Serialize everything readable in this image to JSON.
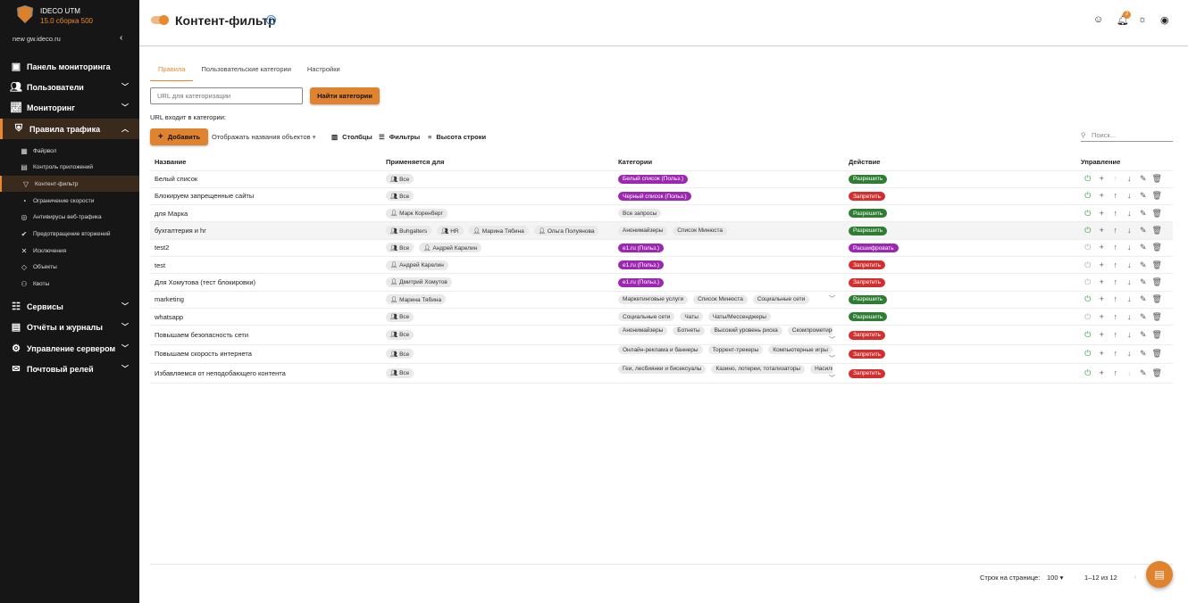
{
  "sidebar": {
    "product": "IDECO UTM",
    "version": "15.0 сборка 500",
    "host": "new gw.ideco.ru",
    "items": [
      {
        "label": "Панель мониторинга",
        "icon": "monitor-icon"
      },
      {
        "label": "Пользователи",
        "icon": "users-icon"
      },
      {
        "label": "Мониторинг",
        "icon": "chart-icon"
      },
      {
        "label": "Правила трафика",
        "icon": "shield-icon"
      },
      {
        "label": "Сервисы",
        "icon": "sliders-icon"
      },
      {
        "label": "Отчёты и журналы",
        "icon": "report-icon"
      },
      {
        "label": "Управление сервером",
        "icon": "gear-icon"
      },
      {
        "label": "Почтовый релей",
        "icon": "mail-icon"
      }
    ],
    "subitems": [
      {
        "label": "Файрвол"
      },
      {
        "label": "Контроль приложений"
      },
      {
        "label": "Контент-фильтр"
      },
      {
        "label": "Ограничение скорости"
      },
      {
        "label": "Антивирусы веб-трафика"
      },
      {
        "label": "Предотвращение вторжений"
      },
      {
        "label": "Исключения"
      },
      {
        "label": "Объекты"
      },
      {
        "label": "Квоты"
      }
    ]
  },
  "header": {
    "title": "Контент-фильтр",
    "notifications": "2"
  },
  "tabs": [
    "Правила",
    "Пользовательские категории",
    "Настройки"
  ],
  "url_check": {
    "placeholder": "URL для категоризации",
    "button": "Найти категории",
    "result_label": "URL входит в категории:"
  },
  "toolbar": {
    "add": "Добавить",
    "display_names": "Отображать названия объектов",
    "columns": "Столбцы",
    "filters": "Фильтры",
    "row_height": "Высота строки",
    "search_placeholder": "Поиск..."
  },
  "colors": {
    "accent": "#e0832e",
    "allow": "#2e7d32",
    "deny": "#d32f2f",
    "decrypt": "#9c27b0"
  },
  "table": {
    "headers": [
      "Название",
      "Применяется для",
      "Категории",
      "Действие",
      "Управление"
    ],
    "rows": [
      {
        "name": "Белый список",
        "applies": [
          [
            "g",
            "Все"
          ]
        ],
        "cats": [
          [
            "p",
            "Белый список (Польз.)"
          ]
        ],
        "action": "Разрешить",
        "type": "allow",
        "enabled": true
      },
      {
        "name": "Блокируем запрещенные сайты",
        "applies": [
          [
            "g",
            "Все"
          ]
        ],
        "cats": [
          [
            "p",
            "Черный список (Польз.)"
          ]
        ],
        "action": "Запретить",
        "type": "deny",
        "enabled": true
      },
      {
        "name": "для Марка",
        "applies": [
          [
            "u",
            "Марк Коренберг"
          ]
        ],
        "cats": [
          [
            "n",
            "Все запросы"
          ]
        ],
        "action": "Разрешить",
        "type": "allow",
        "enabled": true
      },
      {
        "name": "бухгалтерия и hr",
        "applies": [
          [
            "g",
            "Buhgalters"
          ],
          [
            "g",
            "HR"
          ],
          [
            "u",
            "Марина Тябина"
          ],
          [
            "u",
            "Ольга Полуянова"
          ]
        ],
        "cats": [
          [
            "n",
            "Анонимайзеры"
          ],
          [
            "n",
            "Список Минюста"
          ]
        ],
        "action": "Разрешить",
        "type": "allow",
        "enabled": true
      },
      {
        "name": "test2",
        "applies": [
          [
            "g",
            "Все"
          ],
          [
            "u",
            "Андрей Карелин"
          ]
        ],
        "cats": [
          [
            "p",
            "e1.ru (Польз.)"
          ]
        ],
        "action": "Расшифровать",
        "type": "decrypt",
        "enabled": false
      },
      {
        "name": "test",
        "applies": [
          [
            "u",
            "Андрей Карелин"
          ]
        ],
        "cats": [
          [
            "p",
            "e1.ru (Польз.)"
          ]
        ],
        "action": "Запретить",
        "type": "deny",
        "enabled": false
      },
      {
        "name": "Для Хомутова (тест блокировки)",
        "applies": [
          [
            "u",
            "Дмитрий Хомутов"
          ]
        ],
        "cats": [
          [
            "p",
            "e1.ru (Польз.)"
          ]
        ],
        "action": "Запретить",
        "type": "deny",
        "enabled": false
      },
      {
        "name": "marketing",
        "applies": [
          [
            "u",
            "Марина Тябина"
          ]
        ],
        "cats": [
          [
            "n",
            "Маркетинговые услуги"
          ],
          [
            "n",
            "Список Минюста"
          ],
          [
            "n",
            "Социальные сети"
          ]
        ],
        "more": true,
        "action": "Разрешить",
        "type": "allow",
        "enabled": true
      },
      {
        "name": "whatsapp",
        "applies": [
          [
            "g",
            "Все"
          ]
        ],
        "cats": [
          [
            "n",
            "Социальные сети"
          ],
          [
            "n",
            "Чаты"
          ],
          [
            "n",
            "Чаты/Мессенджеры"
          ]
        ],
        "action": "Разрешить",
        "type": "allow",
        "enabled": false
      },
      {
        "name": "Повышаем безопасность сети",
        "applies": [
          [
            "g",
            "Все"
          ]
        ],
        "cats": [
          [
            "n",
            "Анонимайзеры"
          ],
          [
            "n",
            "Ботнеты"
          ],
          [
            "n",
            "Высокий уровень риска"
          ],
          [
            "n",
            "Скомпрометированные"
          ]
        ],
        "more": true,
        "action": "Запретить",
        "type": "deny",
        "enabled": true
      },
      {
        "name": "Повышаем скорость интернета",
        "applies": [
          [
            "g",
            "Все"
          ]
        ],
        "cats": [
          [
            "n",
            "Онлайн-реклама и баннеры"
          ],
          [
            "n",
            "Торрент-трекеры"
          ],
          [
            "n",
            "Компьютерные игры"
          ]
        ],
        "more": true,
        "action": "Запретить",
        "type": "deny",
        "enabled": true
      },
      {
        "name": "Избавляемся от неподобающего контента",
        "applies": [
          [
            "g",
            "Все"
          ]
        ],
        "cats": [
          [
            "n",
            "Геи, лесбиянки и бисексуалы"
          ],
          [
            "n",
            "Казино, лотереи, тотализаторы"
          ],
          [
            "n",
            "Насилие"
          ]
        ],
        "more": true,
        "action": "Запретить",
        "type": "deny",
        "enabled": true
      }
    ]
  },
  "pagination": {
    "rows_label": "Строк на странице:",
    "rows_value": "100",
    "range": "1–12 из 12"
  }
}
